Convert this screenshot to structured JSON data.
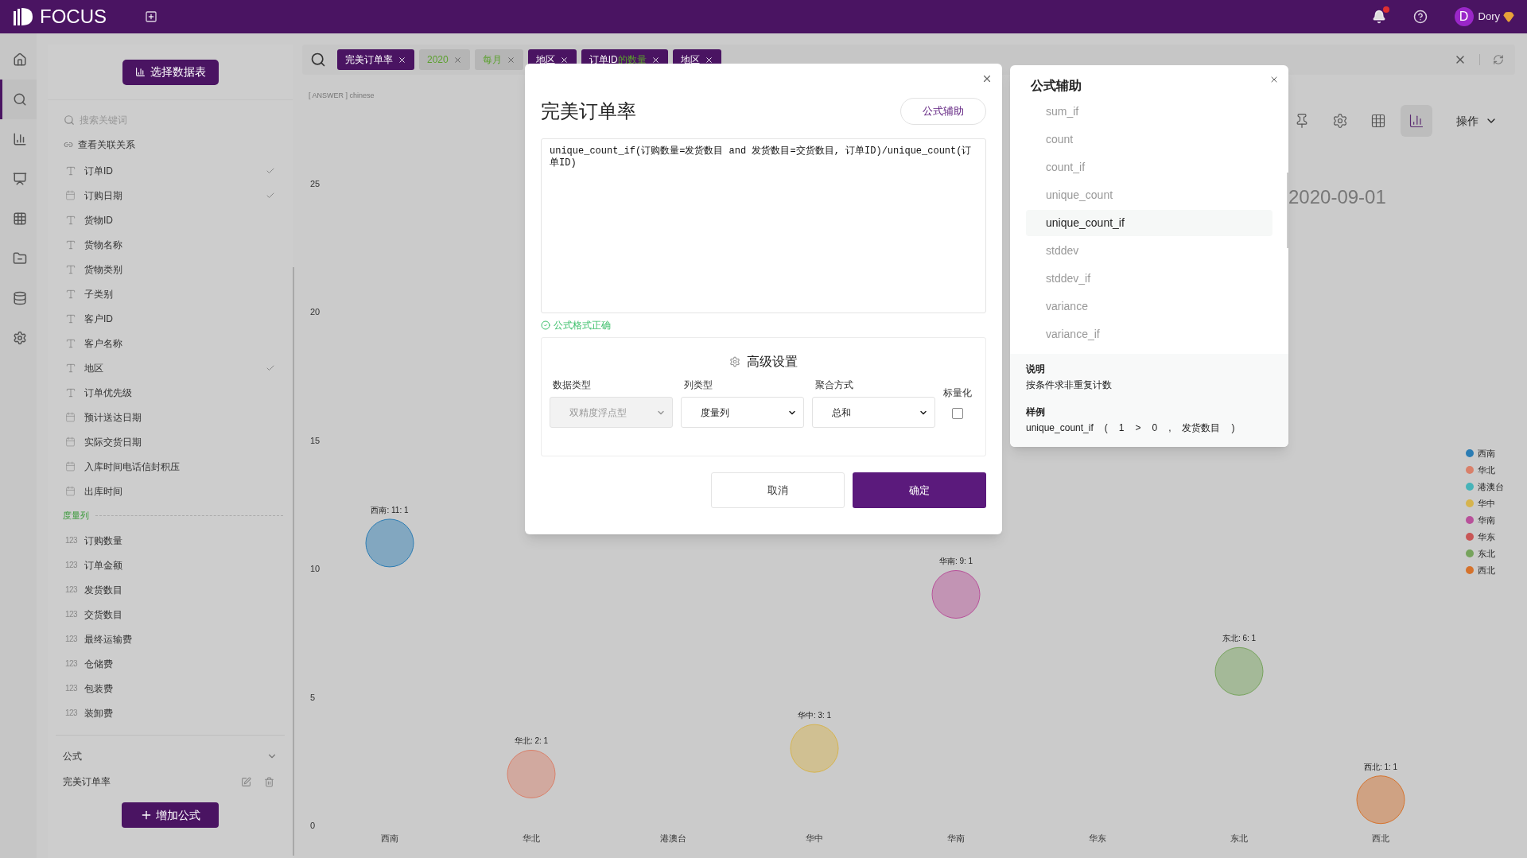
{
  "app": {
    "logo_text": "FOCUS",
    "user_initial": "D",
    "user_name": "Dory",
    "notification_dot": true
  },
  "rail": [
    {
      "selected": false
    },
    {
      "selected": true
    },
    {
      "selected": false
    },
    {
      "selected": false
    },
    {
      "selected": false
    },
    {
      "selected": false
    },
    {
      "selected": false
    },
    {
      "selected": false
    }
  ],
  "sidebar": {
    "select_table_button": "选择数据表",
    "search_placeholder": "搜索关键词",
    "relations_link": "查看关联关系",
    "columns": [
      {
        "kind": "text",
        "name": "订单ID",
        "checked": true
      },
      {
        "kind": "date",
        "name": "订购日期",
        "checked": true
      },
      {
        "kind": "text",
        "name": "货物ID",
        "checked": false
      },
      {
        "kind": "text",
        "name": "货物名称",
        "checked": false
      },
      {
        "kind": "text",
        "name": "货物类别",
        "checked": false
      },
      {
        "kind": "text",
        "name": "子类别",
        "checked": false
      },
      {
        "kind": "text",
        "name": "客户ID",
        "checked": false
      },
      {
        "kind": "text",
        "name": "客户名称",
        "checked": false
      },
      {
        "kind": "text",
        "name": "地区",
        "checked": true
      },
      {
        "kind": "text",
        "name": "订单优先级",
        "checked": false
      },
      {
        "kind": "date",
        "name": "预计送达日期",
        "checked": false
      },
      {
        "kind": "date",
        "name": "实际交货日期",
        "checked": false
      },
      {
        "kind": "date",
        "name": "入库时间电话信封积压",
        "checked": false
      },
      {
        "kind": "date",
        "name": "出库时间",
        "checked": false
      },
      {
        "kind": "section",
        "name": "度量列"
      },
      {
        "kind": "number",
        "icon_text": "123",
        "name": "订购数量",
        "checked": false
      },
      {
        "kind": "number",
        "icon_text": "123",
        "name": "订单金额",
        "checked": false
      },
      {
        "kind": "number",
        "icon_text": "123",
        "name": "发货数目",
        "checked": false
      },
      {
        "kind": "number",
        "icon_text": "123",
        "name": "交货数目",
        "checked": false
      },
      {
        "kind": "number",
        "icon_text": "123",
        "name": "最终运输费",
        "checked": false
      },
      {
        "kind": "number",
        "icon_text": "123",
        "name": "仓储费",
        "checked": false
      },
      {
        "kind": "number",
        "icon_text": "123",
        "name": "包装费",
        "checked": false
      },
      {
        "kind": "number",
        "icon_text": "123",
        "name": "装卸费",
        "checked": false
      }
    ],
    "formula_header": "公式",
    "formula_expanded": true,
    "formulas": [
      "完美订单率"
    ],
    "add_formula_button": "增加公式"
  },
  "search_tags": [
    {
      "parts": [
        {
          "kind": "column",
          "text": "完美订单率"
        }
      ]
    },
    {
      "parts": [
        {
          "kind": "keyword",
          "text": "2020"
        }
      ]
    },
    {
      "parts": [
        {
          "kind": "keyword",
          "text": "每月"
        }
      ]
    },
    {
      "parts": [
        {
          "kind": "column",
          "text": "地区"
        }
      ]
    },
    {
      "parts": [
        {
          "kind": "column",
          "text": "订单ID"
        },
        {
          "kind": "keyword",
          "text": "的数量"
        }
      ]
    },
    {
      "parts": [
        {
          "kind": "column",
          "text": "地区"
        }
      ]
    }
  ],
  "answer_label": "[ ANSWER ] chinese",
  "chart_title_fragment": "2020-09-01",
  "toolbar": [
    {
      "selected": false
    },
    {
      "selected": false
    },
    {
      "selected": false
    },
    {
      "selected": true
    }
  ],
  "actions_menu": "操作",
  "chart_data": {
    "type": "scatter",
    "legend": "right",
    "categories": [
      "西南",
      "华北",
      "港澳台",
      "华中",
      "华南",
      "华东",
      "东北",
      "西北"
    ],
    "ylim": [
      0,
      25
    ],
    "yticks": [
      0,
      5,
      10,
      15,
      20,
      25
    ],
    "series": [
      {
        "name": "西南",
        "color": "#2b7cb3",
        "values": [
          11,
          null,
          null,
          null,
          null,
          null,
          null,
          null
        ]
      },
      {
        "name": "华北",
        "color": "#d9806a",
        "values": [
          null,
          2,
          null,
          null,
          null,
          null,
          null,
          null
        ]
      },
      {
        "name": "港澳台",
        "color": "#47b3b8",
        "values": [
          null,
          null,
          null,
          null,
          null,
          null,
          null,
          null
        ]
      },
      {
        "name": "华中",
        "color": "#d6b44e",
        "values": [
          null,
          null,
          null,
          3,
          null,
          null,
          null,
          null
        ]
      },
      {
        "name": "华南",
        "color": "#b8519a",
        "values": [
          null,
          null,
          null,
          null,
          9,
          null,
          null,
          null
        ]
      },
      {
        "name": "华东",
        "color": "#c85656",
        "values": [
          null,
          null,
          null,
          null,
          null,
          null,
          null,
          null
        ]
      },
      {
        "name": "东北",
        "color": "#76a35c",
        "values": [
          null,
          null,
          null,
          null,
          null,
          null,
          6,
          null
        ]
      },
      {
        "name": "西北",
        "color": "#d5722c",
        "values": [
          null,
          null,
          null,
          null,
          null,
          null,
          null,
          1
        ]
      }
    ],
    "value_labels": [
      "西南: 11: 1",
      "华北: 2: 1",
      null,
      "华中: 3: 1",
      "华南: 9: 1",
      null,
      "东北: 6: 1",
      "西北: 1: 1"
    ]
  },
  "formula_dialog": {
    "title": "完美订单率",
    "helper_button": "公式辅助",
    "formula": "unique_count_if(订购数量=发货数目 and 发货数目=交货数目, 订单ID)/unique_count(订单ID)",
    "valid_message": "公式格式正确",
    "advanced_title": "高级设置",
    "fields": [
      {
        "kind": "select",
        "label": "数据类型",
        "value": "双精度浮点型",
        "disabled": true
      },
      {
        "kind": "select",
        "label": "列类型",
        "value": "度量列",
        "disabled": false
      },
      {
        "kind": "select",
        "label": "聚合方式",
        "value": "总和",
        "disabled": false
      },
      {
        "kind": "checkbox",
        "label": "标量化",
        "checked": false
      }
    ],
    "cancel_button": "取消",
    "confirm_button": "确定"
  },
  "formula_helper": {
    "title": "公式辅助",
    "functions": [
      {
        "name": "sum_if",
        "selected": false
      },
      {
        "name": "count",
        "selected": false
      },
      {
        "name": "count_if",
        "selected": false
      },
      {
        "name": "unique_count",
        "selected": false
      },
      {
        "name": "unique_count_if",
        "selected": true
      },
      {
        "name": "stddev",
        "selected": false
      },
      {
        "name": "stddev_if",
        "selected": false
      },
      {
        "name": "variance",
        "selected": false
      },
      {
        "name": "variance_if",
        "selected": false
      }
    ],
    "description_label": "说明",
    "description": "按条件求非重复计数",
    "example_label": "样例",
    "example_tokens": [
      "unique_count_if",
      "(",
      "1",
      ">",
      "0",
      ",",
      "发货数目",
      ")"
    ]
  }
}
